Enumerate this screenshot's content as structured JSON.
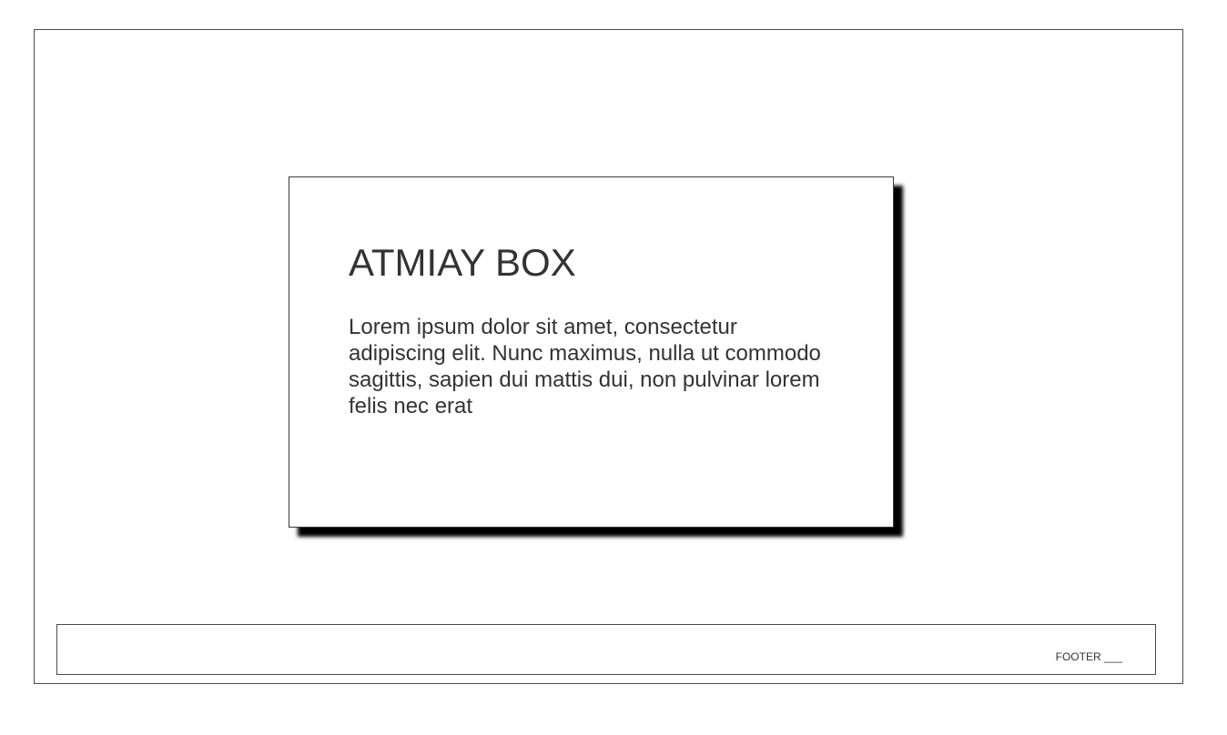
{
  "card": {
    "title": "ATMIAY BOX",
    "body": "Lorem ipsum dolor sit amet, consectetur adipiscing elit. Nunc maximus, nulla ut commodo sagittis, sapien dui mattis dui, non pulvinar lorem felis nec erat"
  },
  "footer": {
    "label": "FOOTER ___"
  }
}
